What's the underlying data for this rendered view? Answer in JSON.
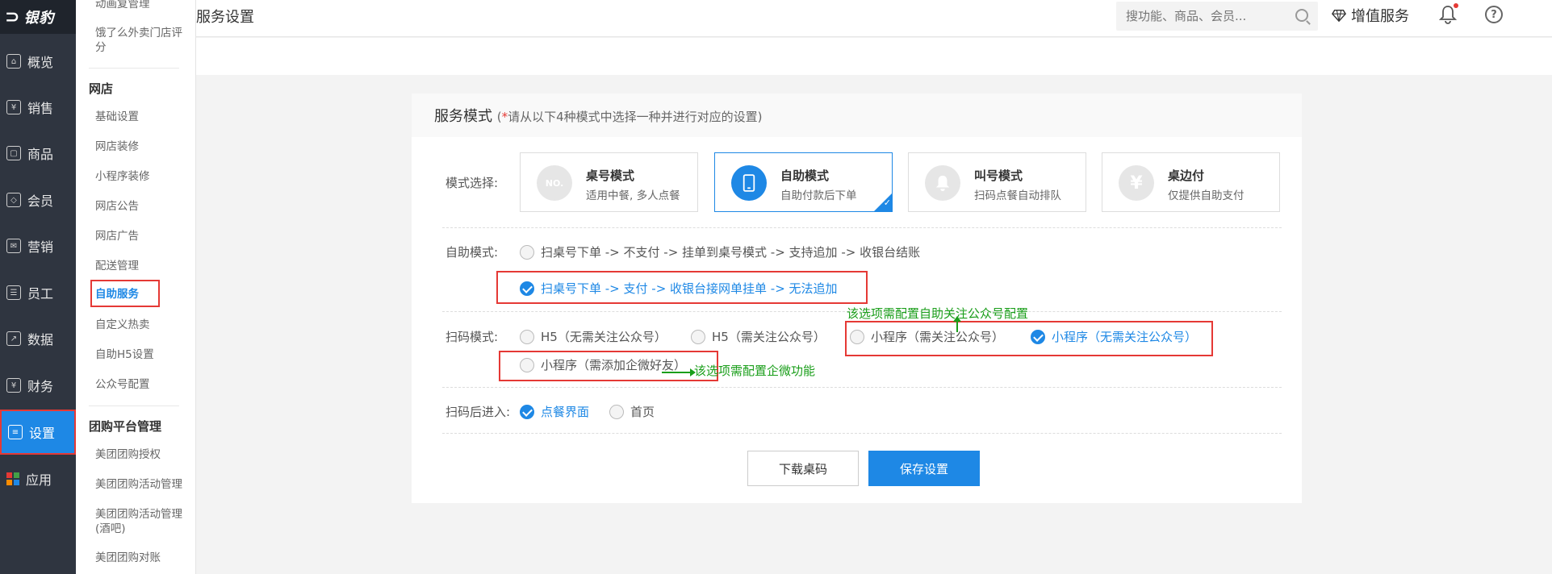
{
  "brand": {
    "logo_mark": "⊃",
    "logo_text": "银豹"
  },
  "sidebar": {
    "items": [
      {
        "label": "概览",
        "icon": "home-icon"
      },
      {
        "label": "销售",
        "icon": "sales-icon"
      },
      {
        "label": "商品",
        "icon": "goods-icon"
      },
      {
        "label": "会员",
        "icon": "member-icon"
      },
      {
        "label": "营销",
        "icon": "marketing-icon"
      },
      {
        "label": "员工",
        "icon": "staff-icon"
      },
      {
        "label": "数据",
        "icon": "data-icon"
      },
      {
        "label": "财务",
        "icon": "finance-icon"
      },
      {
        "label": "设置",
        "icon": "settings-icon",
        "active": true
      },
      {
        "label": "应用",
        "icon": "apps-icon"
      }
    ]
  },
  "subnav": {
    "top_items": [
      "动画复管理",
      "饿了么外卖门店评分"
    ],
    "group1_title": "网店",
    "group1_items": [
      "基础设置",
      "网店装修",
      "小程序装修",
      "网店公告",
      "网店广告",
      "配送管理",
      "自助服务",
      "自定义热卖",
      "自助H5设置",
      "公众号配置"
    ],
    "group2_title": "团购平台管理",
    "group2_items": [
      "美团团购授权",
      "美团团购活动管理",
      "美团团购活动管理(酒吧)",
      "美团团购对账"
    ]
  },
  "header": {
    "page_title": "服务设置",
    "search_placeholder": "搜功能、商品、会员...",
    "vas_label": "增值服务",
    "help_label": "?"
  },
  "card": {
    "title": "服务模式",
    "hint_prefix": "(",
    "hint_star": "*",
    "hint_text": "请从以下4种模式中选择一种并进行对应的设置)",
    "mode_label": "模式选择:",
    "modes": [
      {
        "name": "桌号模式",
        "desc": "适用中餐, 多人点餐",
        "icon_text": "NO."
      },
      {
        "name": "自助模式",
        "desc": "自助付款后下单",
        "icon_text": "▯",
        "selected": true
      },
      {
        "name": "叫号模式",
        "desc": "扫码点餐自动排队",
        "icon_text": "🔔"
      },
      {
        "name": "桌边付",
        "desc": "仅提供自助支付",
        "icon_text": "¥"
      }
    ],
    "self_label": "自助模式:",
    "self_options": [
      "扫桌号下单 -> 不支付 -> 挂单到桌号模式 -> 支持追加 -> 收银台结账",
      "扫桌号下单 -> 支付 -> 收银台接网单挂单 -> 无法追加"
    ],
    "scan_label": "扫码模式:",
    "scan_options": [
      "H5（无需关注公众号）",
      "H5（需关注公众号）",
      "小程序（需关注公众号）",
      "小程序（无需关注公众号）",
      "小程序（需添加企微好友）"
    ],
    "scan_note_1": "该选项需配置自助关注公众号配置",
    "scan_note_2": "该选项需配置企微功能",
    "enter_label": "扫码后进入:",
    "enter_options": [
      "点餐界面",
      "首页"
    ],
    "btn_download": "下载桌码",
    "btn_save": "保存设置"
  },
  "colors": {
    "accent": "#1e88e5",
    "annotation_red": "#e53935",
    "annotation_green": "#1a9e1a",
    "sidebar_bg": "#2f3540"
  }
}
